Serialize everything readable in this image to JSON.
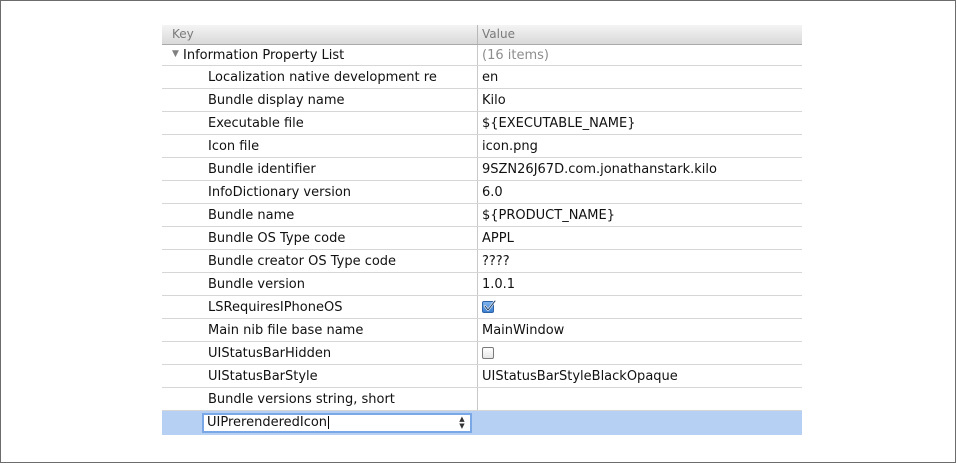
{
  "header": {
    "key_label": "Key",
    "value_label": "Value"
  },
  "root": {
    "key": "Information Property List",
    "value": "(16 items)",
    "disclosure_icon": "triangle-down-icon"
  },
  "rows": [
    {
      "key": "Localization native development re",
      "value": "en"
    },
    {
      "key": "Bundle display name",
      "value": "Kilo"
    },
    {
      "key": "Executable file",
      "value": "${EXECUTABLE_NAME}"
    },
    {
      "key": "Icon file",
      "value": "icon.png"
    },
    {
      "key": "Bundle identifier",
      "value": "9SZN26J67D.com.jonathanstark.kilo"
    },
    {
      "key": "InfoDictionary version",
      "value": "6.0"
    },
    {
      "key": "Bundle name",
      "value": "${PRODUCT_NAME}"
    },
    {
      "key": "Bundle OS Type code",
      "value": "APPL"
    },
    {
      "key": "Bundle creator OS Type code",
      "value": "????"
    },
    {
      "key": "Bundle version",
      "value": "1.0.1"
    },
    {
      "key": "LSRequiresIPhoneOS",
      "value": "",
      "checkbox": true,
      "checked": true
    },
    {
      "key": "Main nib file base name",
      "value": "MainWindow"
    },
    {
      "key": "UIStatusBarHidden",
      "value": "",
      "checkbox": true,
      "checked": false
    },
    {
      "key": "UIStatusBarStyle",
      "value": "UIStatusBarStyleBlackOpaque"
    },
    {
      "key": "Bundle versions string, short",
      "value": ""
    }
  ],
  "editing_row": {
    "key_input_value": "UIPrerenderedIcon",
    "value": "",
    "stepper_icon": "up-down-stepper-icon"
  },
  "colors": {
    "selection": "#b6d0f4",
    "checkbox_checked": "#3c7fd1"
  }
}
